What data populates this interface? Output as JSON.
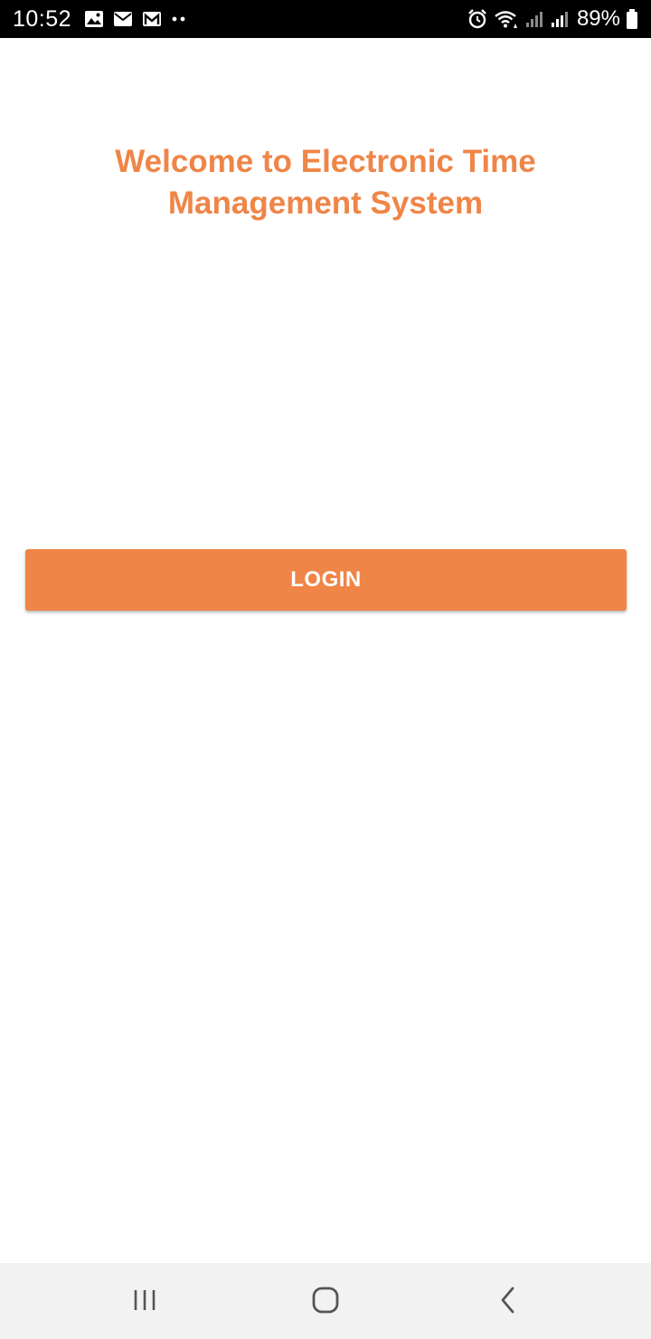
{
  "status_bar": {
    "time": "10:52",
    "battery_percent": "89%",
    "notification_icons": [
      "image-icon",
      "email-icon",
      "gmail-icon",
      "more-notifications-icon"
    ],
    "system_icons": [
      "alarm-icon",
      "wifi-icon",
      "signal-icon",
      "signal-icon",
      "battery-icon"
    ]
  },
  "main": {
    "title": "Welcome to Electronic Time Management System",
    "login_label": "LOGIN"
  },
  "nav_bar": {
    "buttons": [
      "recent-apps-icon",
      "home-icon",
      "back-icon"
    ]
  },
  "colors": {
    "accent": "#EF8547",
    "status_bar_bg": "#000000",
    "nav_bar_bg": "#F2F2F2",
    "background": "#FFFFFF"
  }
}
